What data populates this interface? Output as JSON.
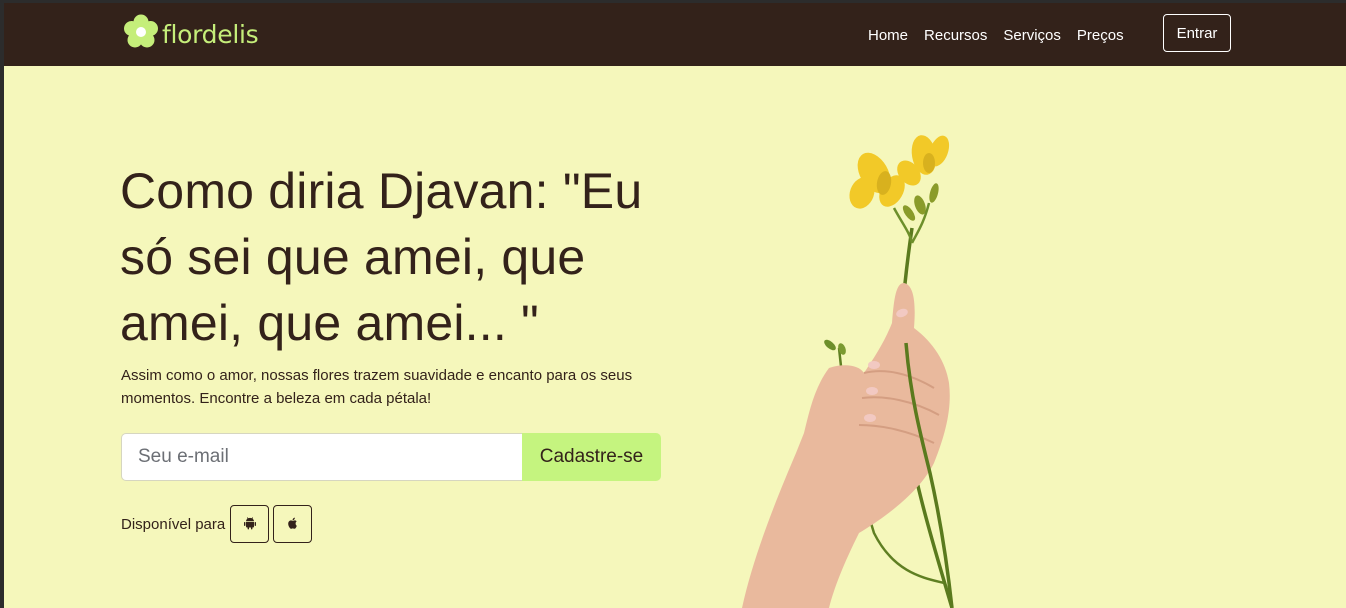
{
  "brand": {
    "name": "flordelis",
    "logo_icon": "flower-icon",
    "logo_color": "#c5ee7a"
  },
  "navbar": {
    "background": "#33221a",
    "links": [
      "Home",
      "Recursos",
      "Serviços",
      "Preços"
    ],
    "login_label": "Entrar"
  },
  "hero": {
    "background": "#f5f7bb",
    "title": "Como diria Djavan: \"Eu só sei que amei, que amei, que amei... \"",
    "subtitle": "Assim como o amor, nossas flores trazem suavidade e encanto para os seus momentos. Encontre a beleza em cada pétala!",
    "email_placeholder": "Seu e-mail",
    "email_value": "",
    "signup_label": "Cadastre-se",
    "signup_color": "#c5f47f",
    "available_label": "Disponível para",
    "stores": [
      {
        "icon": "android-icon"
      },
      {
        "icon": "apple-icon"
      }
    ],
    "image": "hand-holding-yellow-flower"
  }
}
